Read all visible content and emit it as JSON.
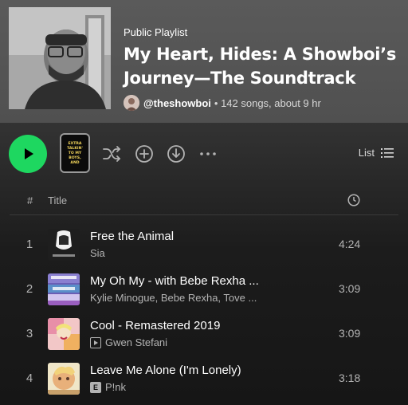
{
  "playlist": {
    "type_label": "Public Playlist",
    "title": "My Heart, Hides: A Showboi’s Journey—The Soundtrack",
    "owner": "@theshowboi",
    "stats": "• 142 songs, about 9 hr"
  },
  "actions": {
    "play": "play-icon",
    "shuffle": "shuffle-icon",
    "add": "add-circle-icon",
    "download": "download-icon",
    "more": "more-icon",
    "mini_cover_text": [
      "EXTRA",
      "TALKIN'",
      "TO MY",
      "BOYS,",
      "AND"
    ],
    "view_label": "List"
  },
  "columns": {
    "number": "#",
    "title": "Title",
    "duration_icon": "clock-icon"
  },
  "tracks": [
    {
      "number": "1",
      "title": "Free the Animal",
      "artist": "Sia",
      "badge": "",
      "duration": "4:24"
    },
    {
      "number": "2",
      "title": "My Oh My - with Bebe Rexha ...",
      "artist": "Kylie Minogue, Bebe Rexha, Tove ...",
      "badge": "",
      "duration": "3:09"
    },
    {
      "number": "3",
      "title": "Cool - Remastered 2019",
      "artist": "Gwen Stefani",
      "badge": "video",
      "duration": "3:09"
    },
    {
      "number": "4",
      "title": "Leave Me Alone (I'm Lonely)",
      "artist": "P!nk",
      "badge": "E",
      "duration": "3:18"
    }
  ],
  "colors": {
    "accent": "#1ed760",
    "header_bg": "#555555",
    "body_bg": "#121212"
  }
}
